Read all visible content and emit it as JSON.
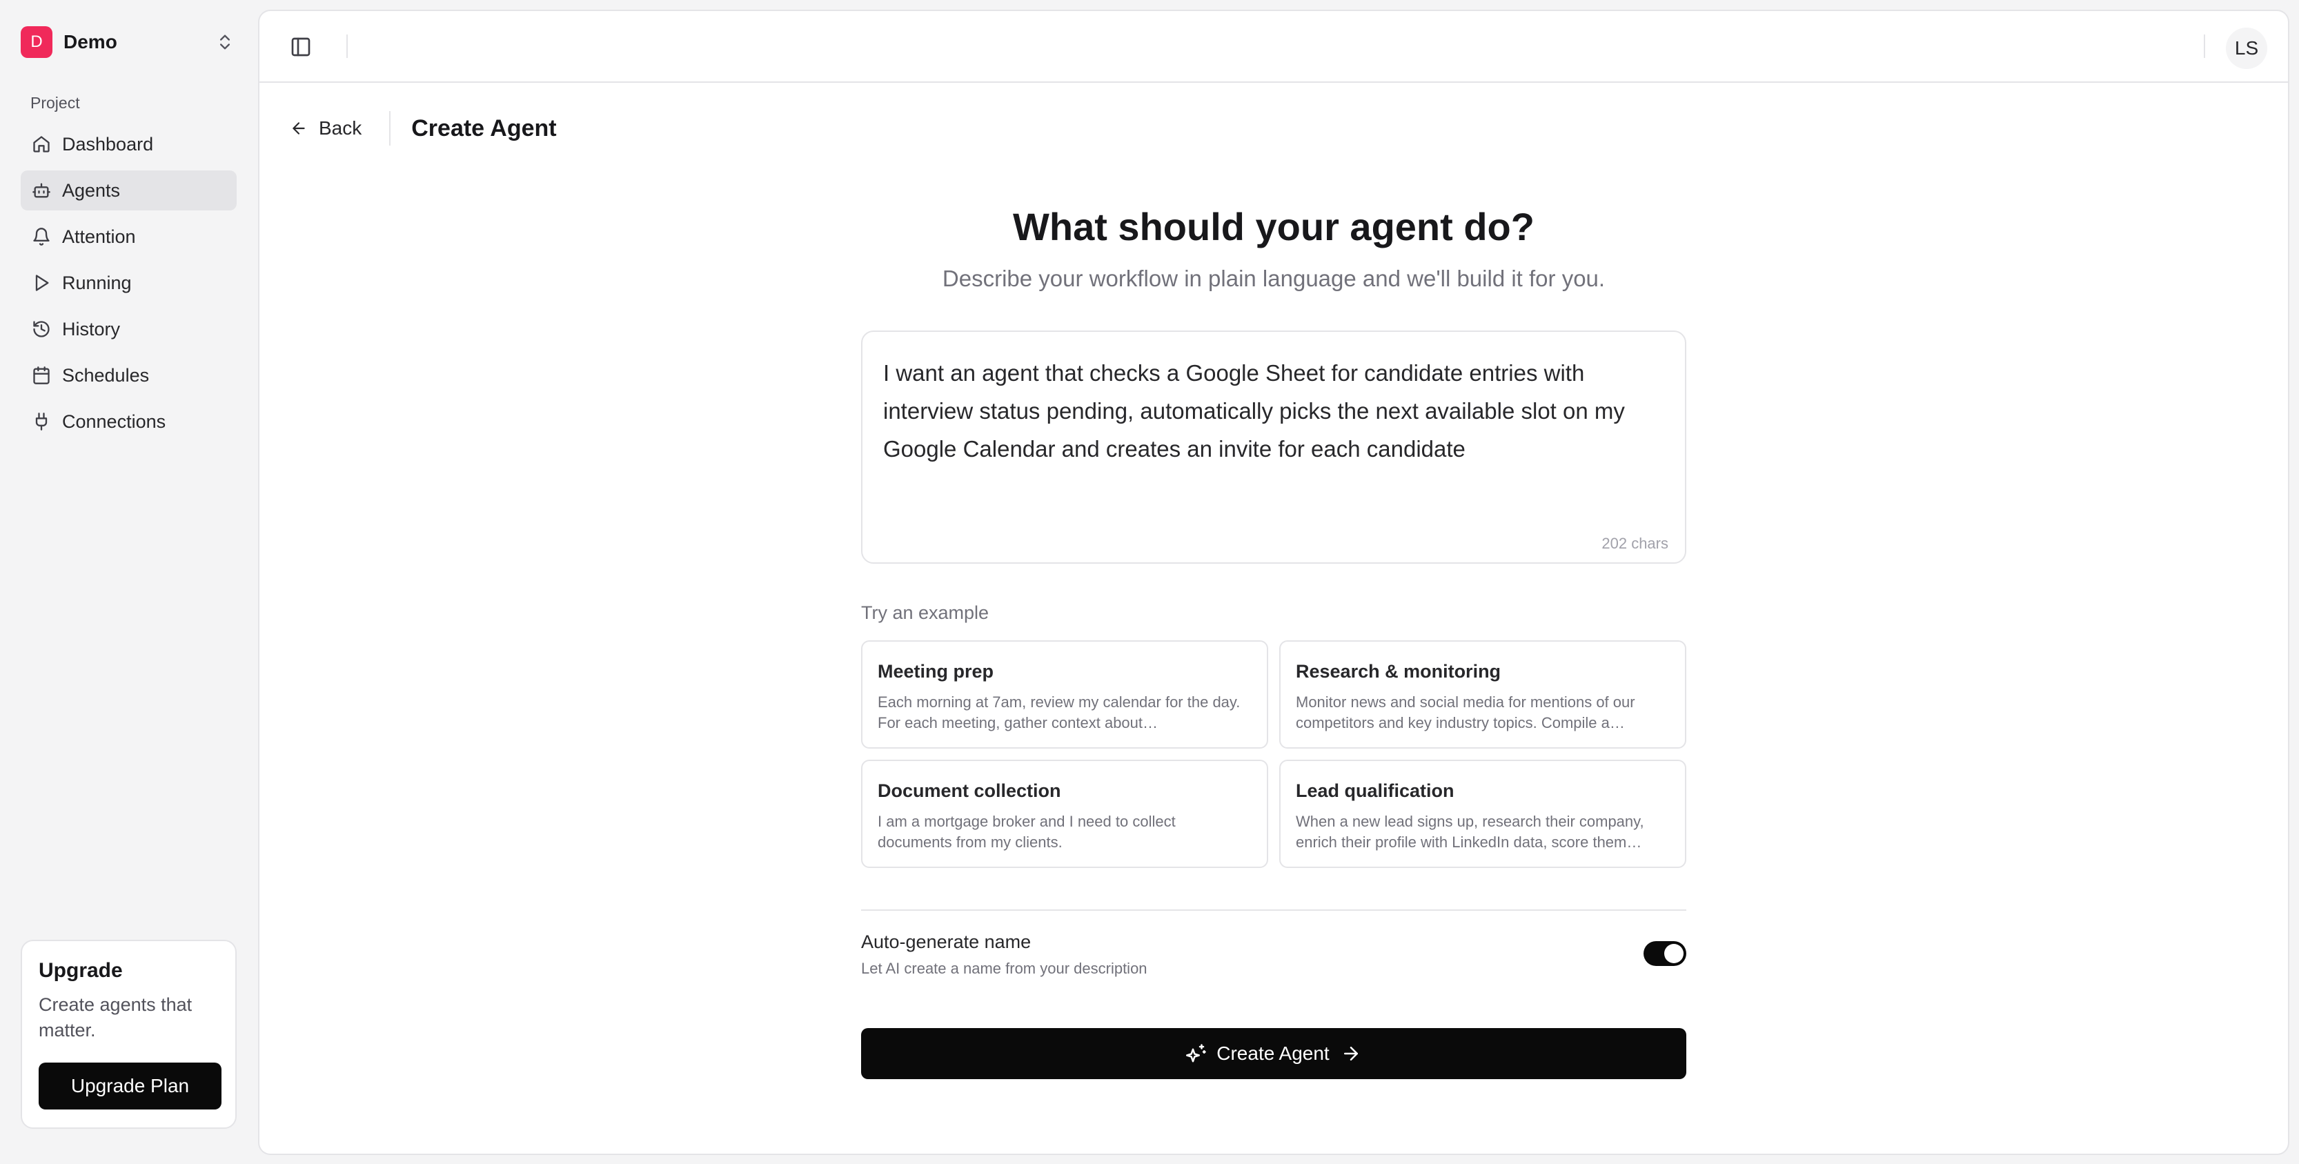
{
  "workspace": {
    "logo_letter": "D",
    "name": "Demo"
  },
  "sidebar": {
    "section_label": "Project",
    "items": [
      {
        "label": "Dashboard",
        "icon": "home-icon"
      },
      {
        "label": "Agents",
        "icon": "bot-icon",
        "active": true
      },
      {
        "label": "Attention",
        "icon": "bell-icon"
      },
      {
        "label": "Running",
        "icon": "play-icon"
      },
      {
        "label": "History",
        "icon": "history-icon"
      },
      {
        "label": "Schedules",
        "icon": "calendar-icon"
      },
      {
        "label": "Connections",
        "icon": "plug-icon"
      }
    ],
    "upgrade": {
      "title": "Upgrade",
      "description": "Create agents that matter.",
      "button": "Upgrade Plan"
    }
  },
  "topbar": {
    "avatar_initials": "LS"
  },
  "header": {
    "back_label": "Back",
    "title": "Create Agent"
  },
  "main": {
    "title": "What should your agent do?",
    "subtitle": "Describe your workflow in plain language and we'll build it for you.",
    "prompt": {
      "text": "I want an agent that checks a Google Sheet for candidate entries with interview status pending, automatically picks the next available slot on my Google Calendar and creates an invite for each candidate",
      "char_count": "202 chars"
    },
    "examples_label": "Try an example",
    "examples": [
      {
        "title": "Meeting prep",
        "description": "Each morning at 7am, review my calendar for the day. For each meeting, gather context about…"
      },
      {
        "title": "Research & monitoring",
        "description": "Monitor news and social media for mentions of our competitors and key industry topics. Compile a…"
      },
      {
        "title": "Document collection",
        "description": "I am a mortgage broker and I need to collect documents from my clients."
      },
      {
        "title": "Lead qualification",
        "description": "When a new lead signs up, research their company, enrich their profile with LinkedIn data, score them…"
      }
    ],
    "auto_generate": {
      "label": "Auto-generate name",
      "description": "Let AI create a name from your description",
      "enabled": true
    },
    "create_button": "Create Agent"
  },
  "colors": {
    "accent": "#0a0a0a",
    "logo": "#f0295a",
    "active_nav": "#e4e4e7"
  }
}
